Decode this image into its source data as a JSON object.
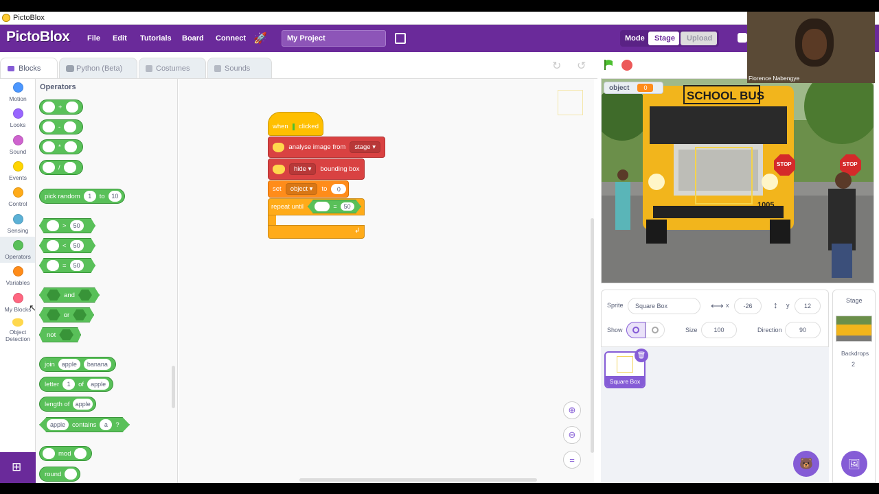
{
  "window": {
    "title": "PictoBlox"
  },
  "menubar": {
    "logo": "PictoBlox",
    "items": [
      "File",
      "Edit",
      "Tutorials",
      "Board",
      "Connect"
    ],
    "project_name": "My Project",
    "mode_label": "Mode",
    "mode_options": [
      "Stage",
      "Upload"
    ],
    "accent": "#6a2a9a"
  },
  "tabs": [
    {
      "label": "Blocks",
      "icon": "blocks-icon"
    },
    {
      "label": "Python (Beta)",
      "icon": "python-icon"
    },
    {
      "label": "Costumes",
      "icon": "brush-icon"
    },
    {
      "label": "Sounds",
      "icon": "speaker-icon"
    }
  ],
  "categories": [
    {
      "label": "Motion",
      "color": "#4c97ff"
    },
    {
      "label": "Looks",
      "color": "#9966ff"
    },
    {
      "label": "Sound",
      "color": "#cf63cf"
    },
    {
      "label": "Events",
      "color": "#ffd500"
    },
    {
      "label": "Control",
      "color": "#ffab19"
    },
    {
      "label": "Sensing",
      "color": "#5cb1d6"
    },
    {
      "label": "Operators",
      "color": "#59c059"
    },
    {
      "label": "Variables",
      "color": "#ff8c1a"
    },
    {
      "label": "My Blocks",
      "color": "#ff6680"
    },
    {
      "label": "Object Detection",
      "color": "#ffd84d"
    }
  ],
  "palette": {
    "heading": "Operators",
    "ops": [
      "+",
      "-",
      "*",
      "/"
    ],
    "pick_random": {
      "text": "pick random",
      "from": "1",
      "to_label": "to",
      "to": "10"
    },
    "compare": [
      {
        "op": ">",
        "value": "50"
      },
      {
        "op": "<",
        "value": "50"
      },
      {
        "op": "=",
        "value": "50"
      }
    ],
    "and_label": "and",
    "or_label": "or",
    "not_label": "not",
    "join": {
      "label": "join",
      "a": "apple",
      "b": "banana"
    },
    "letter": {
      "label": "letter",
      "n": "1",
      "of": "of",
      "word": "apple"
    },
    "length": {
      "label": "length of",
      "word": "apple"
    },
    "contains": {
      "word": "apple",
      "label": "contains",
      "ch": "a",
      "q": "?"
    },
    "mod_label": "mod",
    "round_label": "round"
  },
  "script": {
    "hat": {
      "when": "when",
      "clicked": "clicked"
    },
    "analyse": {
      "label": "analyse image from",
      "option": "stage"
    },
    "bbox": {
      "option": "hide",
      "label": "bounding box"
    },
    "set": {
      "label": "set",
      "var": "object",
      "to": "to",
      "value": "0"
    },
    "repeat": {
      "label": "repeat until",
      "value": "50",
      "op": "="
    }
  },
  "stage": {
    "monitor_label": "object",
    "monitor_value": "0",
    "bus_sign": "SCHOOL BUS",
    "bus_number": "1005",
    "stop_text": "STOP"
  },
  "sprite_info": {
    "sprite_label": "Sprite",
    "sprite_name": "Square Box",
    "x_label": "x",
    "x": "-26",
    "y_label": "y",
    "y": "12",
    "show_label": "Show",
    "size_label": "Size",
    "size": "100",
    "direction_label": "Direction",
    "direction": "90"
  },
  "sprite_thumb_label": "Square Box",
  "stage_panel": {
    "label": "Stage",
    "backdrops_label": "Backdrops",
    "backdrops_count": "2"
  },
  "webcam": {
    "name": "Florence Nabengye"
  }
}
